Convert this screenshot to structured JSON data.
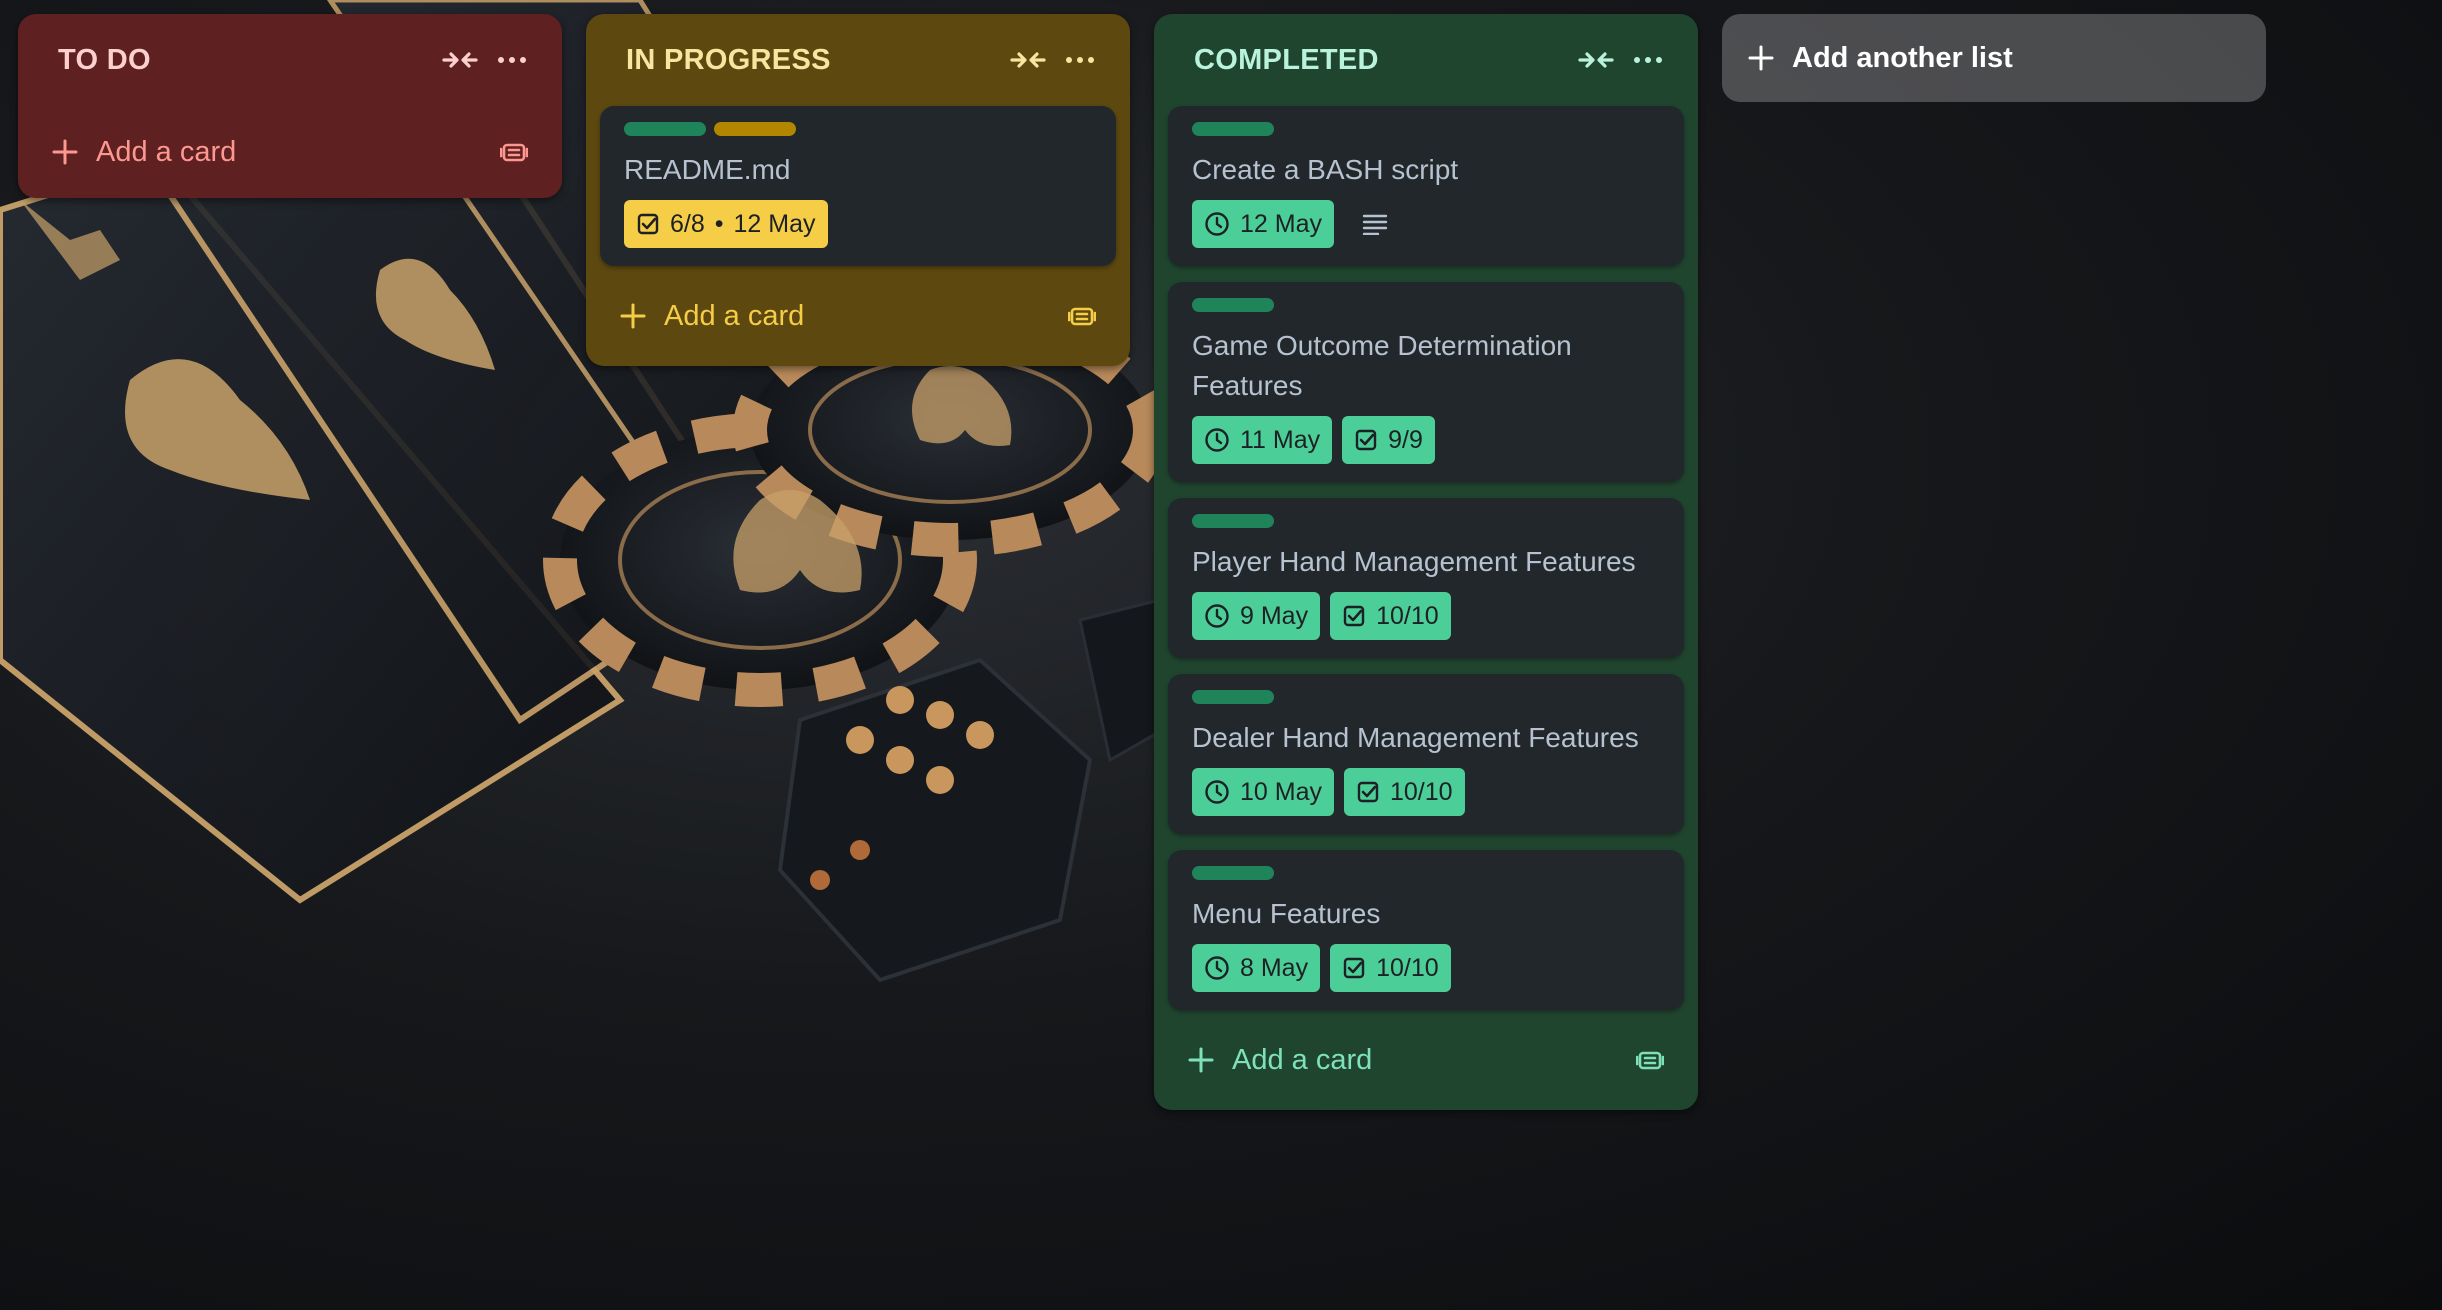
{
  "colors": {
    "todo_bg": "#5e2020",
    "in_progress_bg": "#5d4810",
    "completed_bg": "#20452f",
    "card_bg": "#22272b",
    "label_green": "#1f845a",
    "label_yellow": "#b38600",
    "badge_green": "#4bce97",
    "badge_yellow": "#f5cd47"
  },
  "icons": {
    "collapse": "collapse-arrows-icon",
    "menu": "more-horizontal-icon",
    "add": "plus-icon",
    "template": "card-template-icon",
    "due": "clock-icon",
    "checklist": "checkbox-icon",
    "description": "description-lines-icon"
  },
  "lists": {
    "todo": {
      "title": "TO DO",
      "add_card_label": "Add a card"
    },
    "in_progress": {
      "title": "IN PROGRESS",
      "add_card_label": "Add a card",
      "cards": [
        {
          "title": "README.md",
          "labels": [
            "green",
            "yellow"
          ],
          "badge_checklist": "6/8",
          "badge_separator": "•",
          "badge_due": "12 May"
        }
      ]
    },
    "completed": {
      "title": "COMPLETED",
      "add_card_label": "Add a card",
      "cards": [
        {
          "title": "Create a BASH script",
          "labels": [
            "green"
          ],
          "due": "12 May",
          "has_description": true
        },
        {
          "title": "Game Outcome Determination Features",
          "labels": [
            "green"
          ],
          "due": "11 May",
          "checklist": "9/9"
        },
        {
          "title": "Player Hand Management Features",
          "labels": [
            "green"
          ],
          "due": "9 May",
          "checklist": "10/10"
        },
        {
          "title": "Dealer Hand Management Features",
          "labels": [
            "green"
          ],
          "due": "10 May",
          "checklist": "10/10"
        },
        {
          "title": "Menu Features",
          "labels": [
            "green"
          ],
          "due": "8 May",
          "checklist": "10/10"
        }
      ]
    }
  },
  "add_list_label": "Add another list"
}
